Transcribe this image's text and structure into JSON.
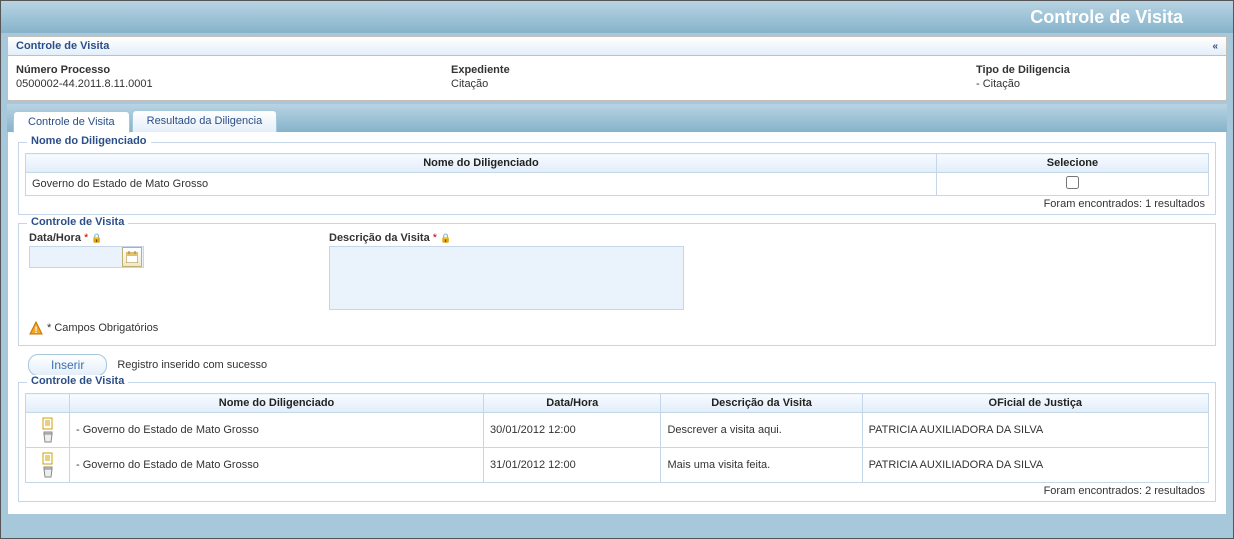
{
  "header": {
    "title": "Controle de Visita"
  },
  "mainPanel": {
    "title": "Controle de Visita",
    "process": {
      "label": "Número Processo",
      "value": "0500002-44.2011.8.11.0001"
    },
    "expediente": {
      "label": "Expediente",
      "value": "Citação"
    },
    "diligencia": {
      "label": "Tipo de Diligencia",
      "value": "- Citação"
    }
  },
  "tabs": {
    "t0": "Controle de Visita",
    "t1": "Resultado da Diligencia"
  },
  "diligenciadoPanel": {
    "title": "Nome do Diligenciado",
    "col_name": "Nome do Diligenciado",
    "col_select": "Selecione",
    "rows": {
      "r0": {
        "name": "Governo do Estado de Mato Grosso"
      }
    },
    "results": "Foram encontrados: 1 resultados"
  },
  "formPanel": {
    "title": "Controle de Visita",
    "date_label": "Data/Hora",
    "desc_label": "Descrição da Visita",
    "required_note": "* Campos Obrigatórios"
  },
  "insert": {
    "button": "Inserir",
    "message": "Registro inserido com sucesso"
  },
  "visitsPanel": {
    "title": "Controle de Visita",
    "col_name": "Nome do Diligenciado",
    "col_date": "Data/Hora",
    "col_desc": "Descrição da Visita",
    "col_officer": "OFicial de Justiça",
    "rows": {
      "r0": {
        "name": "- Governo do Estado de Mato Grosso",
        "date": "30/01/2012 12:00",
        "desc": "Descrever a visita aqui.",
        "officer": "PATRICIA AUXILIADORA DA SILVA"
      },
      "r1": {
        "name": "- Governo do Estado de Mato Grosso",
        "date": "31/01/2012 12:00",
        "desc": "Mais uma visita feita.",
        "officer": "PATRICIA AUXILIADORA DA SILVA"
      }
    },
    "results": "Foram encontrados: 2 resultados"
  }
}
